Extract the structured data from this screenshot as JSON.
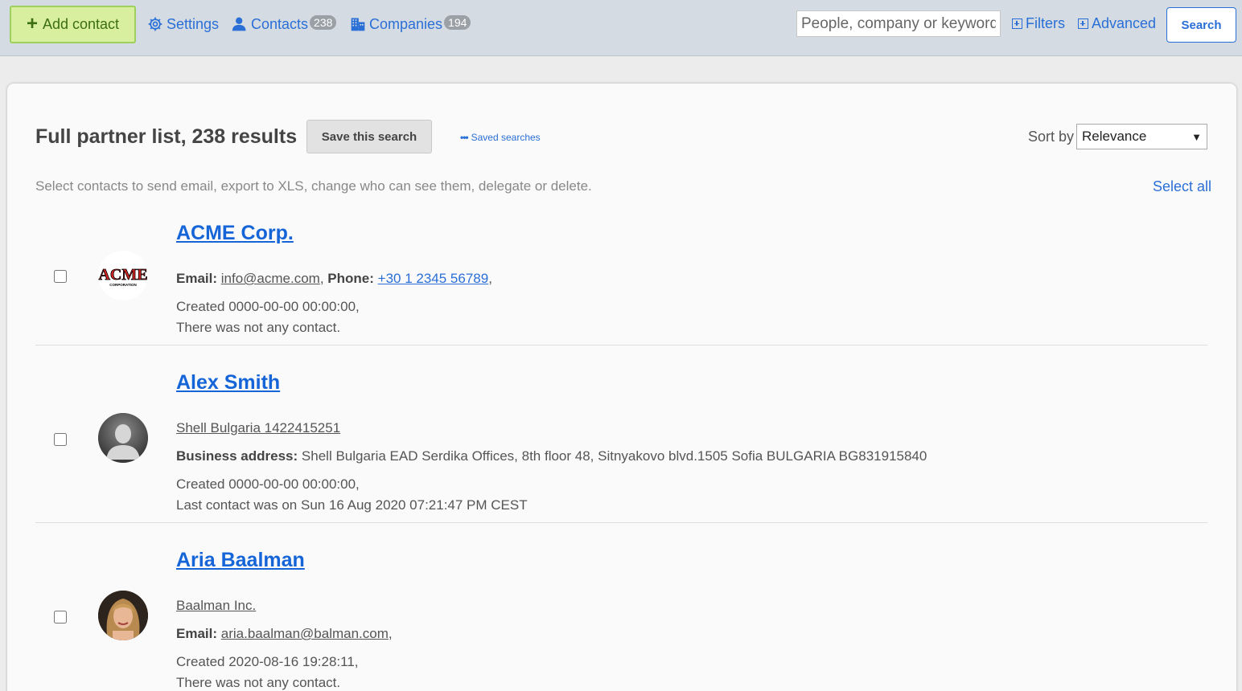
{
  "topbar": {
    "add_contact_label": "Add contact",
    "settings_label": "Settings",
    "contacts_label": "Contacts",
    "contacts_count": "238",
    "companies_label": "Companies",
    "companies_count": "194",
    "search_placeholder": "People, company or keyword",
    "filters_label": "Filters",
    "advanced_label": "Advanced",
    "search_button_label": "Search"
  },
  "list_header": {
    "title": "Full partner list, 238 results",
    "save_search_label": "Save this search",
    "saved_searches_label": "Saved searches",
    "sort_by_label": "Sort by",
    "sort_value": "Relevance",
    "hint": "Select contacts to send email, export to XLS, change who can see them, delegate or delete.",
    "select_all_label": "Select all"
  },
  "contacts": [
    {
      "name": "ACME Corp.",
      "avatar": "acme-logo",
      "email_label": "Email:",
      "email": "info@acme.com",
      "phone_label": "Phone:",
      "phone": "+30 1 2345 56789",
      "created": "Created 0000-00-00 00:00:00,",
      "last_contact": "There was not any contact."
    },
    {
      "name": "Alex Smith",
      "avatar": "default-person",
      "company": "Shell Bulgaria 1422415251",
      "address_label": "Business address:",
      "address": "Shell Bulgaria EAD Serdika Offices, 8th floor 48, Sitnyakovo blvd.1505 Sofia BULGARIA BG831915840",
      "created": "Created 0000-00-00 00:00:00,",
      "last_contact": "Last contact was on Sun 16 Aug 2020 07:21:47 PM CEST"
    },
    {
      "name": "Aria Baalman",
      "avatar": "person-photo",
      "company": "Baalman Inc.",
      "email_label": "Email:",
      "email": "aria.baalman@balman.com",
      "created": "Created 2020-08-16 19:28:11,",
      "last_contact": "There was not any contact."
    }
  ],
  "colors": {
    "topbar_bg": "#d4dbe3",
    "link_blue": "#2a6fd6",
    "add_button_bg": "#d7ef9e"
  }
}
